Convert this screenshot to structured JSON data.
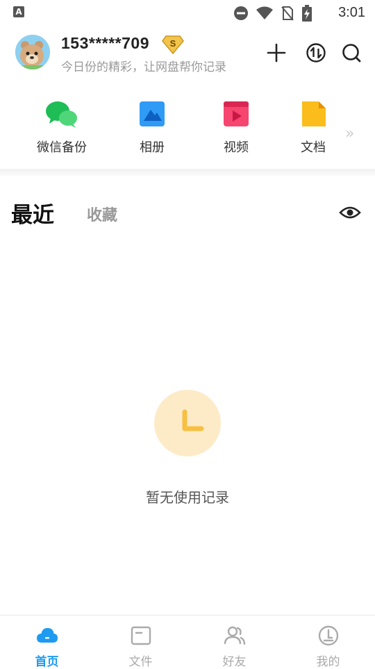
{
  "status_bar": {
    "notif_letter": "A",
    "time": "3:01"
  },
  "header": {
    "user_name": "153*****709",
    "vip_letter": "S",
    "subtitle": "今日份的精彩，让网盘帮你记录"
  },
  "quick_access": [
    {
      "label": "微信备份",
      "icon": "wechat-icon"
    },
    {
      "label": "相册",
      "icon": "album-icon"
    },
    {
      "label": "视频",
      "icon": "video-icon"
    },
    {
      "label": "文档",
      "icon": "document-icon"
    }
  ],
  "tabs": {
    "recent": "最近",
    "favorites": "收藏"
  },
  "empty_state": {
    "message": "暂无使用记录"
  },
  "bottom_nav": [
    {
      "label": "首页",
      "active": true
    },
    {
      "label": "文件",
      "active": false
    },
    {
      "label": "好友",
      "active": false
    },
    {
      "label": "我的",
      "active": false
    }
  ],
  "colors": {
    "accent": "#1e9bf0",
    "empty_circle": "#fdebc8",
    "empty_clock": "#f7c043"
  }
}
